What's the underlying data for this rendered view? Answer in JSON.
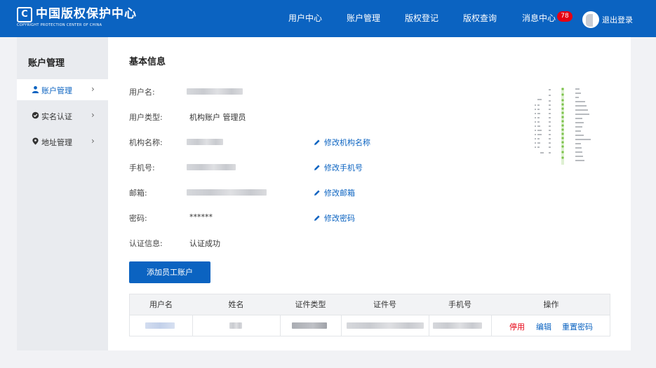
{
  "header": {
    "logo_mark": "C",
    "logo_name": "中国版权保护中心",
    "logo_sub": "COPYRIGHT PROTECTION CENTER OF CHINA",
    "nav": [
      "用户中心",
      "账户管理",
      "版权登记",
      "版权查询",
      "消息中心"
    ],
    "message_count": "78",
    "logout": "退出登录"
  },
  "sidebar": {
    "title": "账户管理",
    "items": [
      {
        "label": "账户管理",
        "icon": "user-icon",
        "active": true
      },
      {
        "label": "实名认证",
        "icon": "badge-icon",
        "active": false
      },
      {
        "label": "地址管理",
        "icon": "location-pin-icon",
        "active": false
      }
    ]
  },
  "main": {
    "title": "基本信息",
    "fields": [
      {
        "label": "用户名:",
        "value": ""
      },
      {
        "label": "用户类型:",
        "value": "机构账户 管理员"
      },
      {
        "label": "机构名称:",
        "value": "",
        "action": "修改机构名称"
      },
      {
        "label": "手机号:",
        "value": "",
        "action": "修改手机号"
      },
      {
        "label": "邮箱:",
        "value": "",
        "action": "修改邮箱"
      },
      {
        "label": "密码:",
        "value": "******",
        "action": "修改密码"
      },
      {
        "label": "认证信息:",
        "value": "认证成功"
      }
    ],
    "add_button": "添加员工账户"
  },
  "table": {
    "columns": [
      "用户名",
      "姓名",
      "证件类型",
      "证件号",
      "手机号",
      "操作"
    ],
    "row_actions": [
      "停用",
      "编辑",
      "重置密码"
    ]
  },
  "colors": {
    "brand": "#0b63c1",
    "danger": "#e60012"
  }
}
